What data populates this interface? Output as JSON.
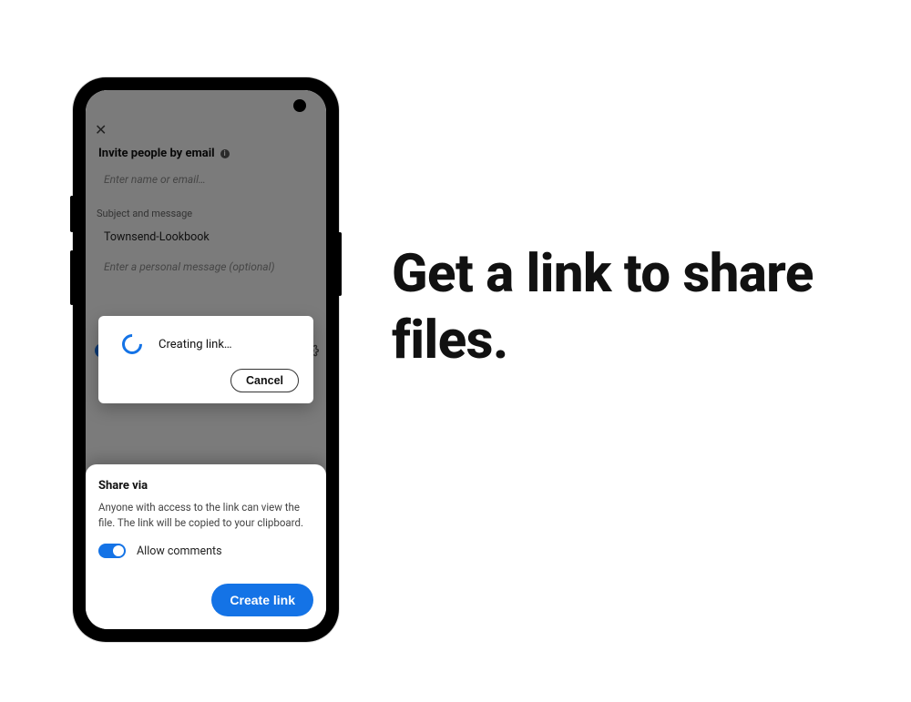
{
  "headline": "Get a link to share files.",
  "screen": {
    "invite_heading": "Invite people by email",
    "name_placeholder": "Enter name or email…",
    "subject_section_label": "Subject and message",
    "subject_value": "Townsend-Lookbook",
    "message_placeholder": "Enter a personal message (optional)"
  },
  "dialog": {
    "status_text": "Creating link…",
    "cancel_label": "Cancel"
  },
  "sheet": {
    "title": "Share via",
    "description": "Anyone with access to the link can view the file. The link will be copied to your clipboard.",
    "allow_comments_label": "Allow comments",
    "create_link_label": "Create link"
  },
  "colors": {
    "accent": "#1473e6"
  }
}
